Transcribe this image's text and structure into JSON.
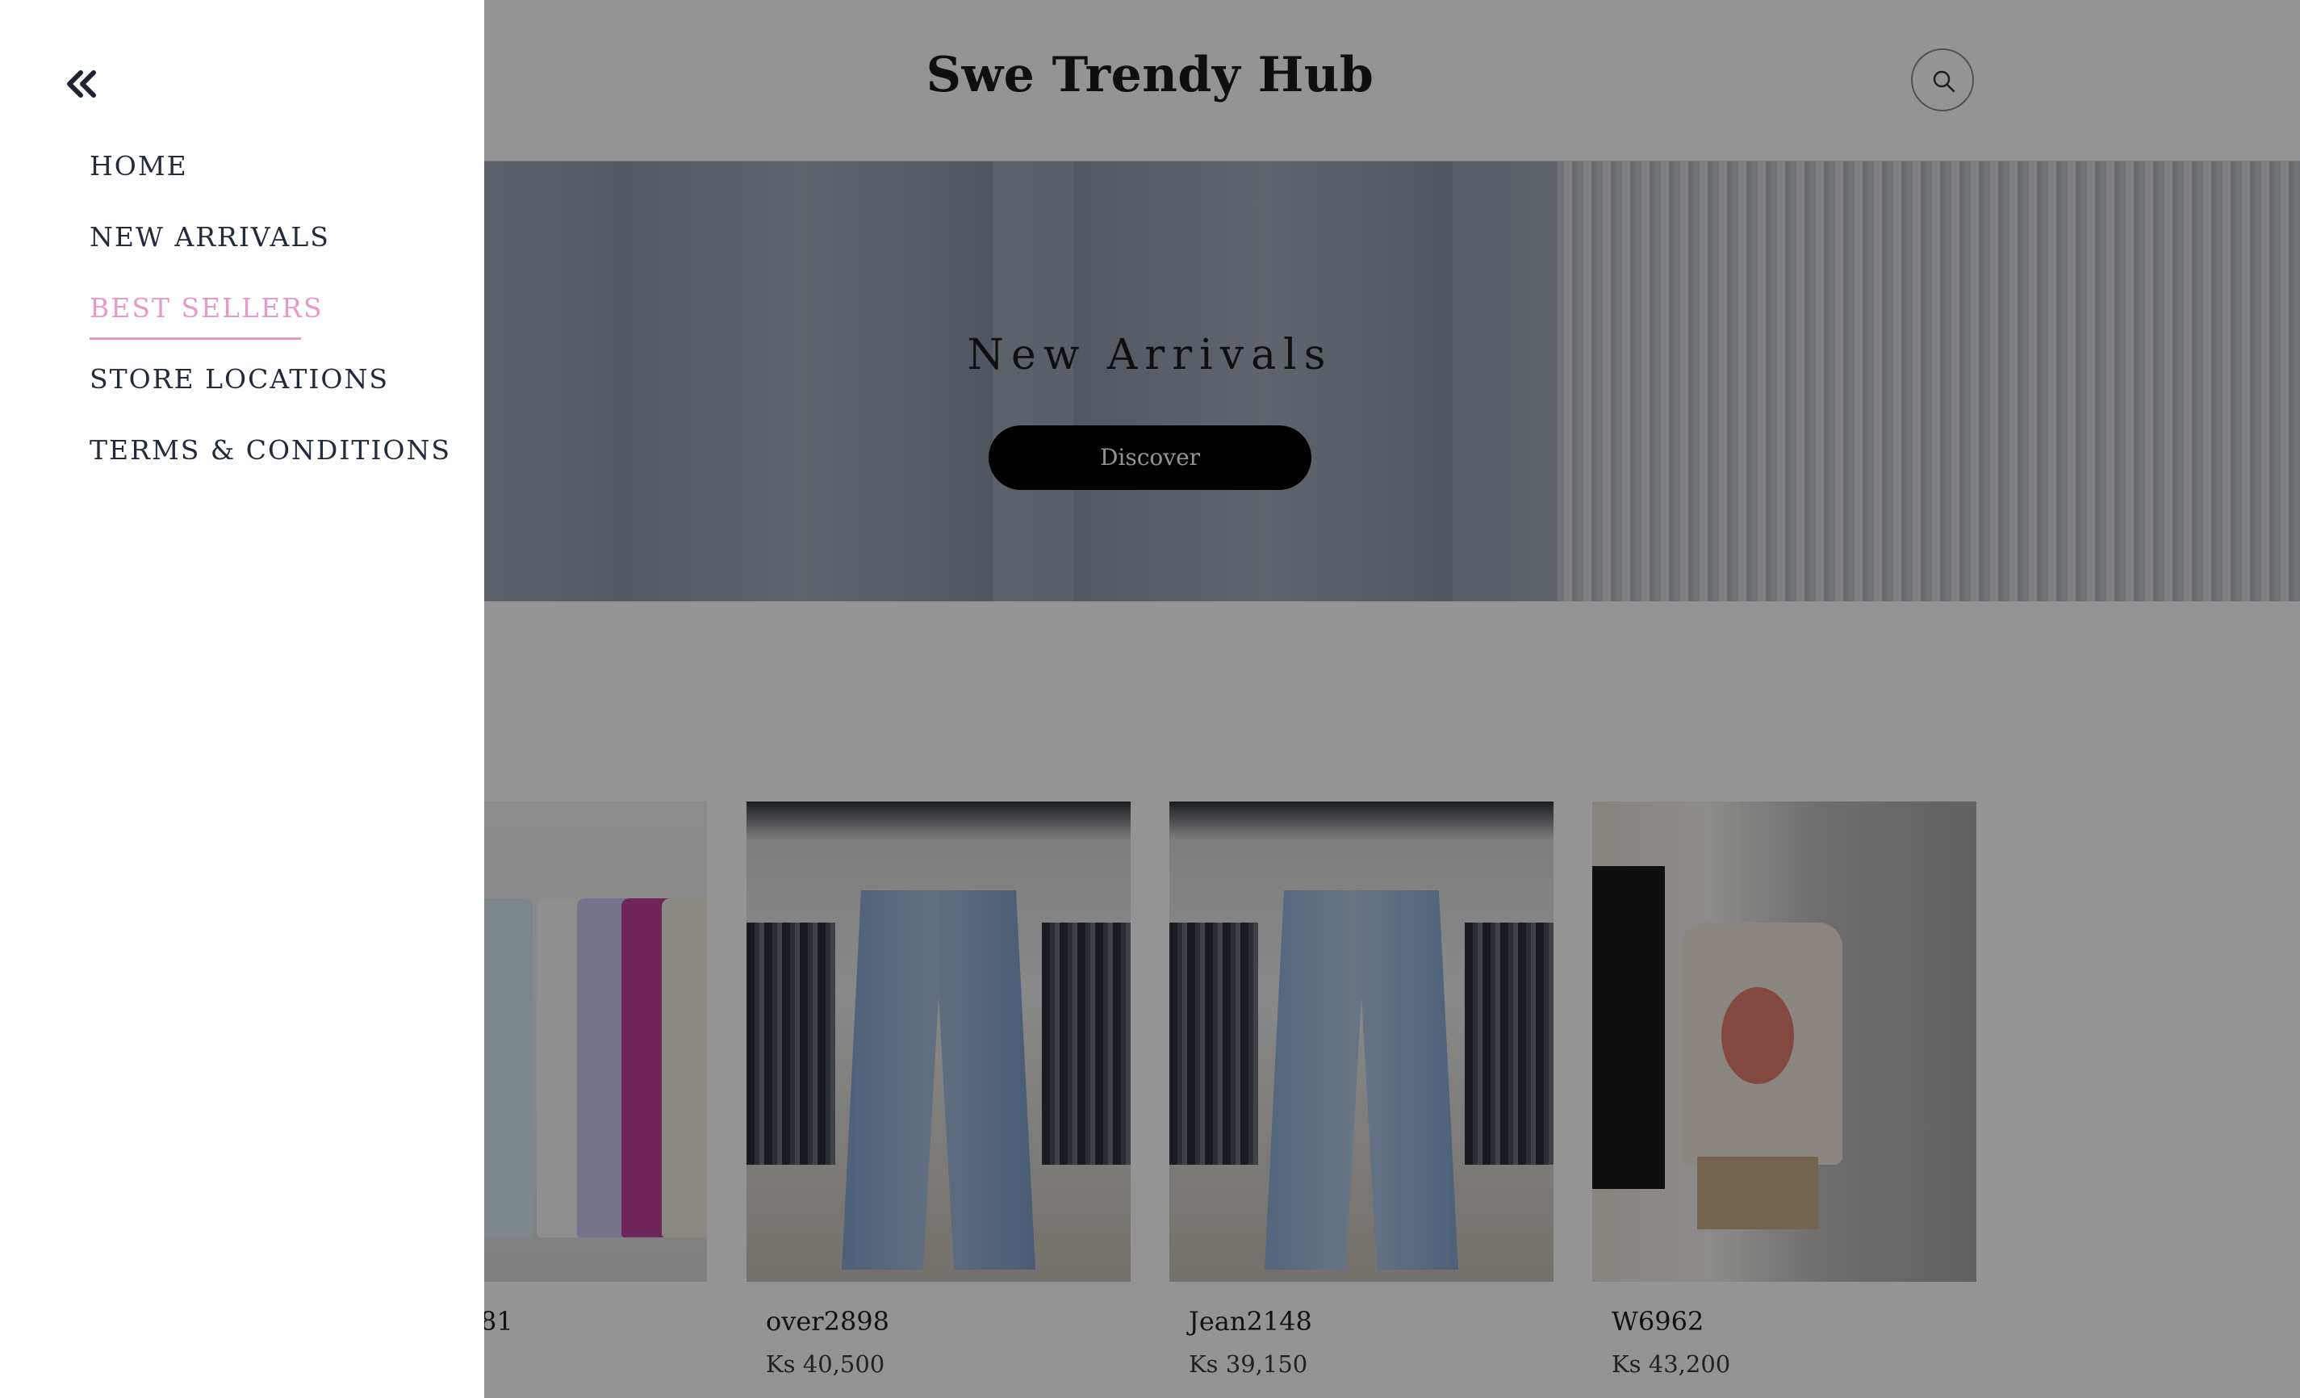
{
  "header": {
    "brand": "Swe Trendy Hub",
    "search_icon": "search-icon"
  },
  "hero": {
    "title": "New Arrivals",
    "button_label": "Discover"
  },
  "products": [
    {
      "name": "81",
      "price": ""
    },
    {
      "name": "over2898",
      "price": "Ks 40,500"
    },
    {
      "name": "Jean2148",
      "price": "Ks 39,150"
    },
    {
      "name": "W6962",
      "price": "Ks 43,200"
    }
  ],
  "drawer": {
    "close_icon": "double-chevron-left-icon",
    "nav": [
      {
        "label": "HOME",
        "active": false
      },
      {
        "label": "NEW ARRIVALS",
        "active": false
      },
      {
        "label": "BEST SELLERS",
        "active": true
      },
      {
        "label": "STORE LOCATIONS",
        "active": false
      },
      {
        "label": "TERMS & CONDITIONS",
        "active": false
      }
    ]
  },
  "colors": {
    "accent_active": "#e79ac7",
    "nav_text": "#232a3a",
    "overlay": "rgba(0,0,0,0.42)"
  }
}
